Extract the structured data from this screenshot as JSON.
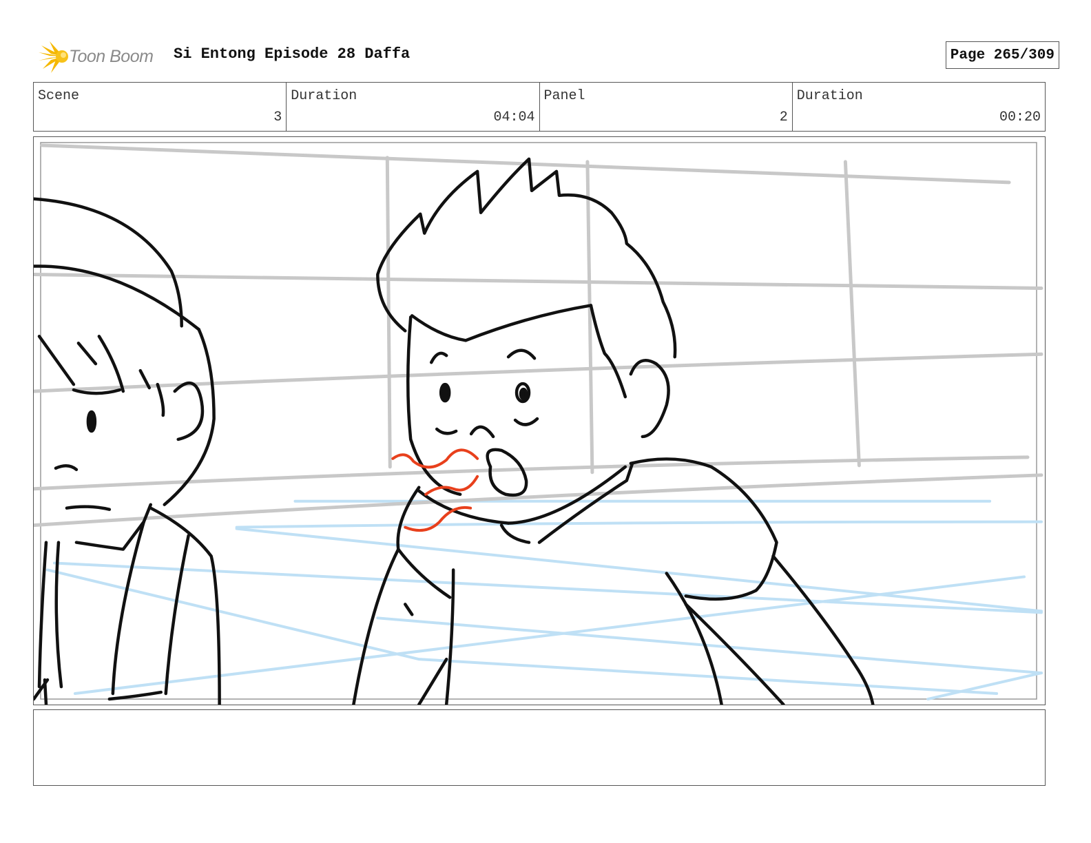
{
  "header": {
    "logo_text": "Toon Boom",
    "title": "Si Entong Episode 28 Daffa",
    "page": "Page 265/309"
  },
  "info": {
    "scene_label": "Scene",
    "scene_value": "3",
    "scene_duration_label": "Duration",
    "scene_duration_value": "04:04",
    "panel_label": "Panel",
    "panel_value": "2",
    "panel_duration_label": "Duration",
    "panel_duration_value": "00:20"
  },
  "colors": {
    "logo_accent": "#f5b800",
    "sketch_line": "#111111",
    "grid_line": "#c8c8c8",
    "blue_line": "#bfe0f5",
    "red_line": "#e8401c"
  },
  "icons": {
    "logo": "burst-logo-icon"
  }
}
